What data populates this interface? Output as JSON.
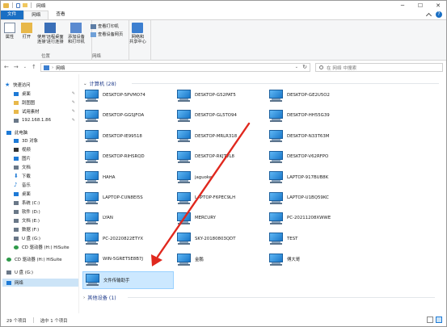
{
  "window": {
    "title": "网络"
  },
  "tabs": {
    "file": "文件",
    "network": "网络",
    "view": "查看"
  },
  "ribbon": {
    "properties": "属性",
    "open": "打开",
    "remote_line1": "使用'远程桌面",
    "remote_line2": "连接'进行连接",
    "add_line1": "添加设备",
    "add_line2": "和打印机",
    "view_printers": "查看打印机",
    "view_web": "查看设备网页",
    "net_center_line1": "网络和",
    "net_center_line2": "共享中心",
    "group_location": "位置",
    "group_network": "网络"
  },
  "address": {
    "path": "网络",
    "search_placeholder": "在 网络 中搜索"
  },
  "nav_pane": {
    "quick_access": "快速访问",
    "desktop_pinned": "桌面",
    "pictures_pinned": "刮图图",
    "materials_pinned": "试用素材",
    "ip_pinned": "192.168.1.86",
    "this_pc": "此电脑",
    "objects3d": "3D 对象",
    "videos": "视频",
    "pictures": "图片",
    "documents": "文档",
    "downloads": "下载",
    "music": "音乐",
    "desktop": "桌面",
    "drive_c": "系统 (C:)",
    "drive_d": "软件 (D:)",
    "drive_e": "文档 (E:)",
    "drive_f": "数据 (F:)",
    "drive_g": "U 盘 (G:)",
    "cd_h": "CD 驱动器 (H:) HiSuite",
    "cd_h2": "CD 驱动器 (H:) HiSuite",
    "drive_g2": "U 盘 (G:)",
    "network": "网络"
  },
  "content": {
    "group_computers": "计算机 (28)",
    "group_other": "其他设备 (1)",
    "computers": [
      "DESKTOP-5PVMO74",
      "DESKTOP-G52PAT5",
      "DESKTOP-GE2U5O2",
      "DESKTOP-GGSJFOA",
      "DESKTOP-GL5TO94",
      "DESKTOP-HH55G39",
      "DESKTOP-IE99518",
      "DESKTOP-MRLR318",
      "DESKTOP-N33T63M",
      "DESKTOP-RIHSRQD",
      "DESKTOP-RKJTVL8",
      "DESKTOP-V62RFPO",
      "HAHA",
      "jaguoke",
      "LAPTOP-917BUB8K",
      "LAPTOP-CUN8EI5S",
      "LAPTOP-F6PEC9LH",
      "LAPTOP-U1BQ59KC",
      "LYAN",
      "MERCURY",
      "PC-20211208XWWE",
      "PC-20220822ETYX",
      "SKY-20180803QDT",
      "TEST",
      "WIN-5GRET5E8B7J",
      "金鹏",
      "傅大哥",
      "文件传输助手"
    ]
  },
  "status": {
    "count": "29 个项目",
    "selected": "选中 1 个项目"
  },
  "colors": {
    "accent": "#1e7ad6",
    "selection": "#cce8ff",
    "arrow": "#e0281e"
  }
}
